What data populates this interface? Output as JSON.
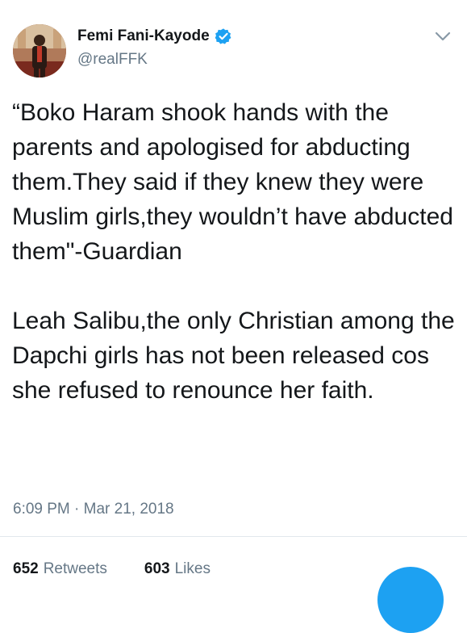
{
  "author": {
    "name": "Femi Fani-Kayode",
    "handle": "@realFFK",
    "verified_icon": "verified-badge-icon",
    "avatar_icon": "profile-photo"
  },
  "menu_icon": "chevron-down-icon",
  "tweet": {
    "paragraph1": "“Boko Haram shook hands with the parents and apologised for abducting them.They said if they knew they were Muslim girls,they wouldn’t have abducted them\"-Guardian",
    "paragraph2": "Leah Salibu,the only Christian among the Dapchi girls has not been released cos she refused to renounce her faith.",
    "timestamp": "6:09 PM · Mar 21, 2018"
  },
  "stats": {
    "retweets_count": "652",
    "retweets_label": "Retweets",
    "likes_count": "603",
    "likes_label": "Likes"
  },
  "colors": {
    "accent": "#1da1f2",
    "text": "#14171a",
    "secondary": "#657786"
  },
  "fab_icon": "compose-tweet-icon"
}
